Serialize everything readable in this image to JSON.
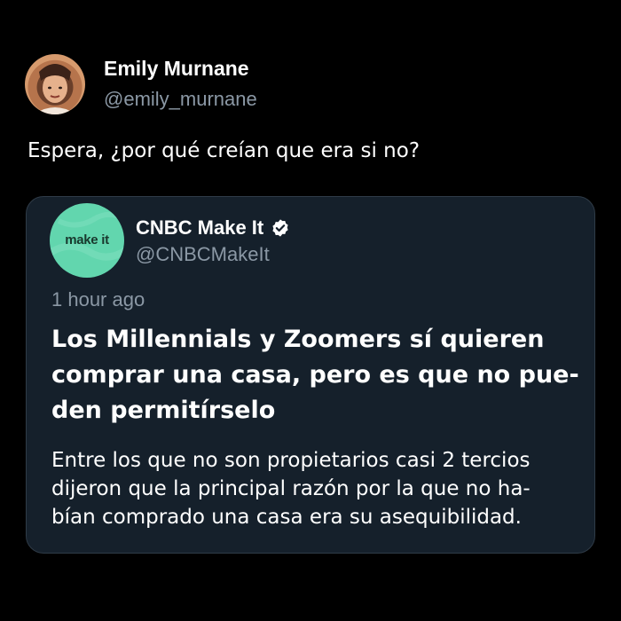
{
  "tweet": {
    "author": {
      "name": "Emily Murnane",
      "handle": "@emily_murnane",
      "avatar_icon": "profile-photo"
    },
    "text": "Espera, ¿por qué creían que era si no?",
    "quoted_card": {
      "logo_text": "make it",
      "logo_color": "#62d6ae",
      "name": "CNBC Make It",
      "verified_icon": "verified-badge-icon",
      "handle": "@CNBCMakeIt",
      "time": "1 hour ago",
      "headline_lines": [
        "Los Millennials y Zoomers sí quieren",
        "comprar una casa, pero es que no pue-",
        "den permitírselo"
      ],
      "body_lines": [
        "Entre los que no son propietarios casi 2 tercios",
        "dijeron que la principal razón por la que no ha-",
        "bían comprado una casa era su asequibilidad."
      ]
    }
  },
  "colors": {
    "background": "#000000",
    "card_background": "#15202b",
    "secondary_text": "#8b98a5"
  }
}
